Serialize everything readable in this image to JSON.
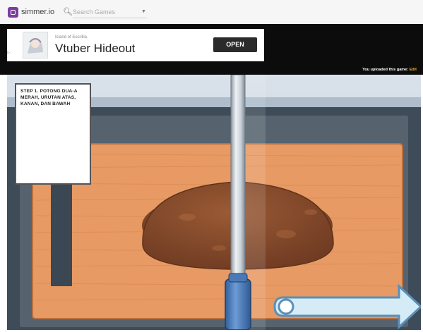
{
  "site": {
    "logo_text": "simmer.io",
    "search_placeholder": "Search Games",
    "search_icon": "search-icon",
    "dropdown_icon": "chevron-down-icon"
  },
  "ad": {
    "subtitle": "Island of Escrillia",
    "title": "Vtuber Hideout",
    "button_label": "OPEN",
    "adchoices_label": "▷"
  },
  "upload_note": {
    "text": "You uploaded this game: ",
    "link": "Edit"
  },
  "game": {
    "instruction_text": "STEP 1.     POTONG DUA-A MERAH, URUTAN ATAS, KANAN, DAN BAWAH",
    "colors": {
      "board": "#e79a63",
      "bread": "#8a4d2e",
      "knife_blade": "#d6dde4",
      "knife_handle": "#4f80bd",
      "arrow": "#d5ecf7"
    },
    "icons": [
      "knife",
      "cut-arrow-right"
    ]
  }
}
